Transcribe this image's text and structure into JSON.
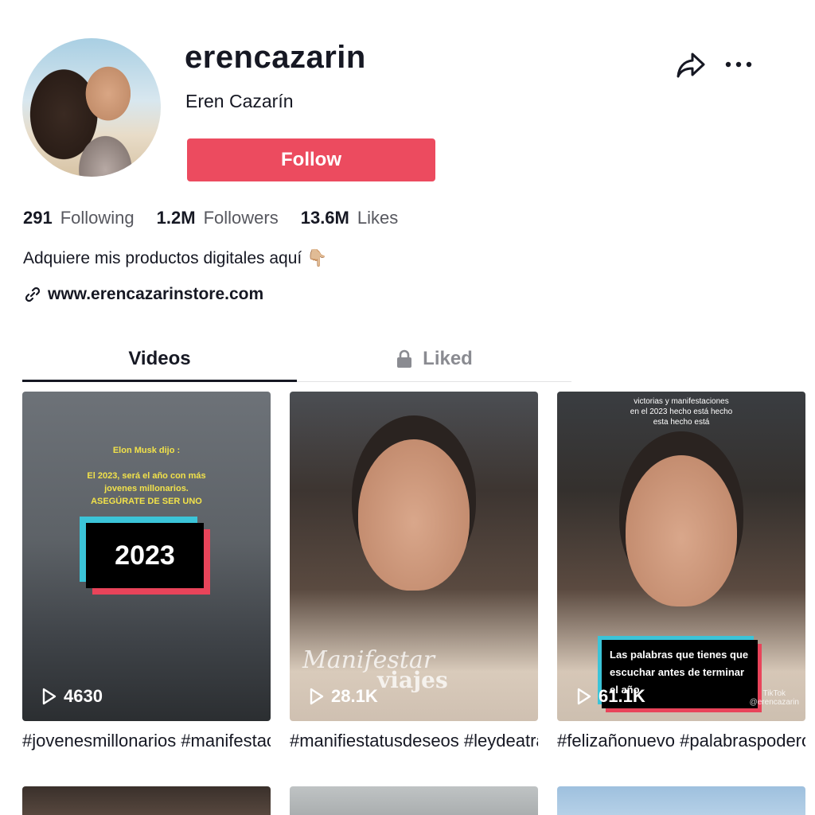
{
  "profile": {
    "username": "erencazarin",
    "display_name": "Eren Cazarín",
    "follow_label": "Follow",
    "bio": "Adquiere mis productos digitales aquí 👇🏼",
    "link": "www.erencazarinstore.com"
  },
  "stats": [
    {
      "value": "291",
      "label": "Following"
    },
    {
      "value": "1.2M",
      "label": "Followers"
    },
    {
      "value": "13.6M",
      "label": "Likes"
    }
  ],
  "tabs": [
    {
      "label": "Videos",
      "active": true
    },
    {
      "label": "Liked",
      "active": false,
      "icon": "lock-icon"
    }
  ],
  "videos": [
    {
      "views": "4630",
      "caption": "#jovenesmillonarios #manifestacion",
      "overlay_title": "Elon Musk dijo :",
      "overlay_lines": [
        "El 2023, será el año con más",
        "jovenes millonarios.",
        "ASEGÚRATE DE SER UNO"
      ],
      "year": "2023"
    },
    {
      "views": "28.1K",
      "caption": "#manifiestatusdeseos #leydeatraccion",
      "watermark_1": "Manifestar",
      "watermark_2": "viajes"
    },
    {
      "views": "61.1K",
      "caption": "#felizañonuevo #palabraspoderosas",
      "top_lines": [
        "victorias y manifestaciones",
        "en el 2023 hecho está hecho",
        "esta hecho está"
      ],
      "box_text": "Las palabras que tienes que escuchar antes de terminar el año",
      "tiktok_mark": "TikTok",
      "tiktok_handle": "@erencazarin"
    }
  ],
  "colors": {
    "follow": "#ec4b5f",
    "text": "#161823",
    "secondary": "#57585f",
    "cyan": "#3bc4d8",
    "red": "#e9445a"
  }
}
